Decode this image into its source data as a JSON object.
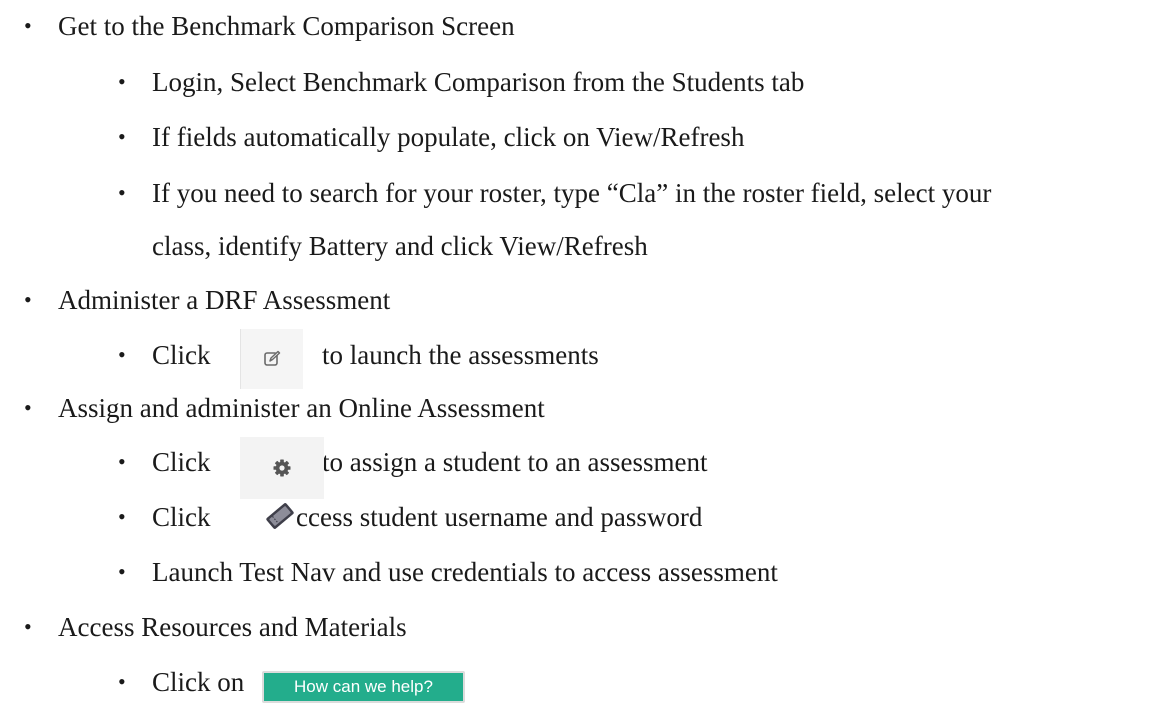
{
  "sections": [
    {
      "title": "Get to the Benchmark Comparison Screen",
      "items": [
        "Login, Select Benchmark Comparison from the Students tab",
        "If fields automatically populate, click on View/Refresh",
        "If you need to search for your roster, type “Cla” in the roster field, select your",
        "class, identify Battery and click View/Refresh"
      ]
    },
    {
      "title": "Administer a DRF Assessment",
      "items": [
        {
          "before": "Click",
          "icon": "edit-icon",
          "after": "to launch the assessments"
        }
      ]
    },
    {
      "title": "Assign and administer an Online Assessment",
      "items": [
        {
          "before": "Click",
          "icon": "gear-icon",
          "after": "to assign a student to an assessment"
        },
        {
          "before": "Click",
          "icon": "ticket-icon",
          "after": "ccess student username and password"
        },
        "Launch Test Nav and use credentials to access assessment"
      ]
    },
    {
      "title": "Access Resources and Materials",
      "items": [
        {
          "before": "Click on",
          "button_label": "How can we help?",
          "button_color": "#23ad8c"
        }
      ]
    }
  ],
  "bullet_char": "•"
}
